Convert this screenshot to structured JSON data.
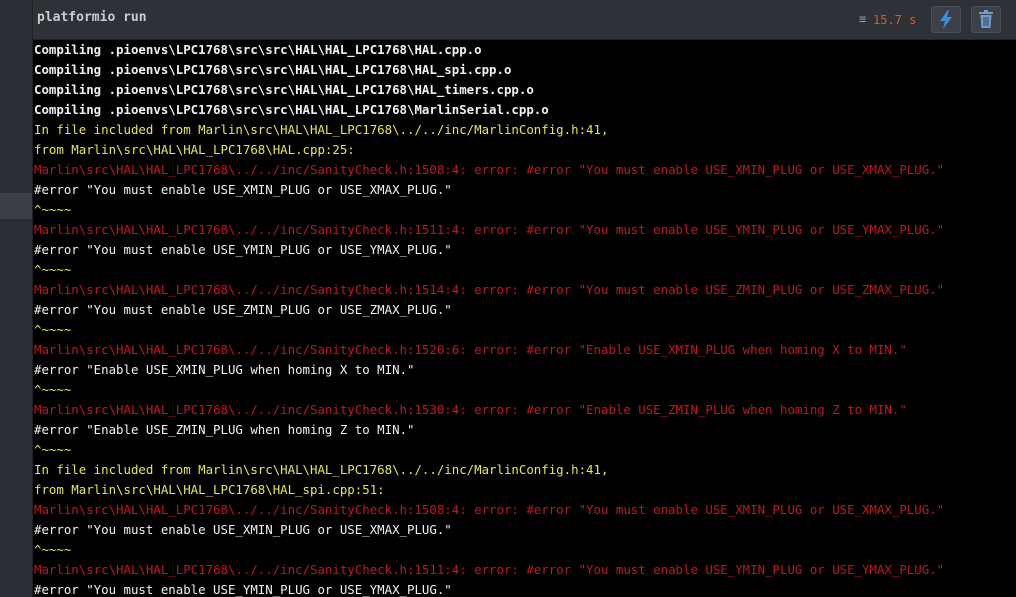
{
  "header": {
    "title": "platformio run",
    "menu_icon": "list-icon",
    "elapsed": "15.7 s",
    "run_icon": "lightning-icon",
    "trash_icon": "trash-icon"
  },
  "colors": {
    "compile": "#f2f2f2",
    "include": "#e8e84a",
    "error": "#c4161c",
    "directive": "#f2f2f2",
    "caret": "#e8e84a",
    "elapsed": "#d35d2c",
    "run_icon": "#3b8fe0"
  },
  "terminal": {
    "lines": [
      {
        "kind": "compile",
        "text": "Compiling .pioenvs\\LPC1768\\src\\src\\HAL\\HAL_LPC1768\\HAL.cpp.o"
      },
      {
        "kind": "compile",
        "text": "Compiling .pioenvs\\LPC1768\\src\\src\\HAL\\HAL_LPC1768\\HAL_spi.cpp.o"
      },
      {
        "kind": "compile",
        "text": "Compiling .pioenvs\\LPC1768\\src\\src\\HAL\\HAL_LPC1768\\HAL_timers.cpp.o"
      },
      {
        "kind": "compile",
        "text": "Compiling .pioenvs\\LPC1768\\src\\src\\HAL\\HAL_LPC1768\\MarlinSerial.cpp.o"
      },
      {
        "kind": "yellow",
        "text": "In file included from Marlin\\src\\HAL\\HAL_LPC1768\\../../inc/MarlinConfig.h:41,"
      },
      {
        "kind": "yellow",
        "text": "from Marlin\\src\\HAL\\HAL_LPC1768\\HAL.cpp:25:"
      },
      {
        "kind": "red",
        "text": "Marlin\\src\\HAL\\HAL_LPC1768\\../../inc/SanityCheck.h:1508:4: error: #error \"You must enable USE_XMIN_PLUG or USE_XMAX_PLUG.\""
      },
      {
        "kind": "white",
        "text": "#error \"You must enable USE_XMIN_PLUG or USE_XMAX_PLUG.\""
      },
      {
        "kind": "yellow",
        "text": "^~~~~"
      },
      {
        "kind": "red",
        "text": "Marlin\\src\\HAL\\HAL_LPC1768\\../../inc/SanityCheck.h:1511:4: error: #error \"You must enable USE_YMIN_PLUG or USE_YMAX_PLUG.\""
      },
      {
        "kind": "white",
        "text": "#error \"You must enable USE_YMIN_PLUG or USE_YMAX_PLUG.\""
      },
      {
        "kind": "yellow",
        "text": "^~~~~"
      },
      {
        "kind": "red",
        "text": "Marlin\\src\\HAL\\HAL_LPC1768\\../../inc/SanityCheck.h:1514:4: error: #error \"You must enable USE_ZMIN_PLUG or USE_ZMAX_PLUG.\""
      },
      {
        "kind": "white",
        "text": "#error \"You must enable USE_ZMIN_PLUG or USE_ZMAX_PLUG.\""
      },
      {
        "kind": "yellow",
        "text": "^~~~~"
      },
      {
        "kind": "red",
        "text": "Marlin\\src\\HAL\\HAL_LPC1768\\../../inc/SanityCheck.h:1520:6: error: #error \"Enable USE_XMIN_PLUG when homing X to MIN.\""
      },
      {
        "kind": "white",
        "text": "#error \"Enable USE_XMIN_PLUG when homing X to MIN.\""
      },
      {
        "kind": "yellow",
        "text": "^~~~~"
      },
      {
        "kind": "red",
        "text": "Marlin\\src\\HAL\\HAL_LPC1768\\../../inc/SanityCheck.h:1530:4: error: #error \"Enable USE_ZMIN_PLUG when homing Z to MIN.\""
      },
      {
        "kind": "white",
        "text": "#error \"Enable USE_ZMIN_PLUG when homing Z to MIN.\""
      },
      {
        "kind": "yellow",
        "text": "^~~~~"
      },
      {
        "kind": "yellow",
        "text": "In file included from Marlin\\src\\HAL\\HAL_LPC1768\\../../inc/MarlinConfig.h:41,"
      },
      {
        "kind": "yellow",
        "text": "from Marlin\\src\\HAL\\HAL_LPC1768\\HAL_spi.cpp:51:"
      },
      {
        "kind": "red",
        "text": "Marlin\\src\\HAL\\HAL_LPC1768\\../../inc/SanityCheck.h:1508:4: error: #error \"You must enable USE_XMIN_PLUG or USE_XMAX_PLUG.\""
      },
      {
        "kind": "white",
        "text": "#error \"You must enable USE_XMIN_PLUG or USE_XMAX_PLUG.\""
      },
      {
        "kind": "yellow",
        "text": "^~~~~"
      },
      {
        "kind": "red",
        "text": "Marlin\\src\\HAL\\HAL_LPC1768\\../../inc/SanityCheck.h:1511:4: error: #error \"You must enable USE_YMIN_PLUG or USE_YMAX_PLUG.\""
      },
      {
        "kind": "white",
        "text": "#error \"You must enable USE_YMIN_PLUG or USE_YMAX_PLUG.\""
      }
    ]
  }
}
